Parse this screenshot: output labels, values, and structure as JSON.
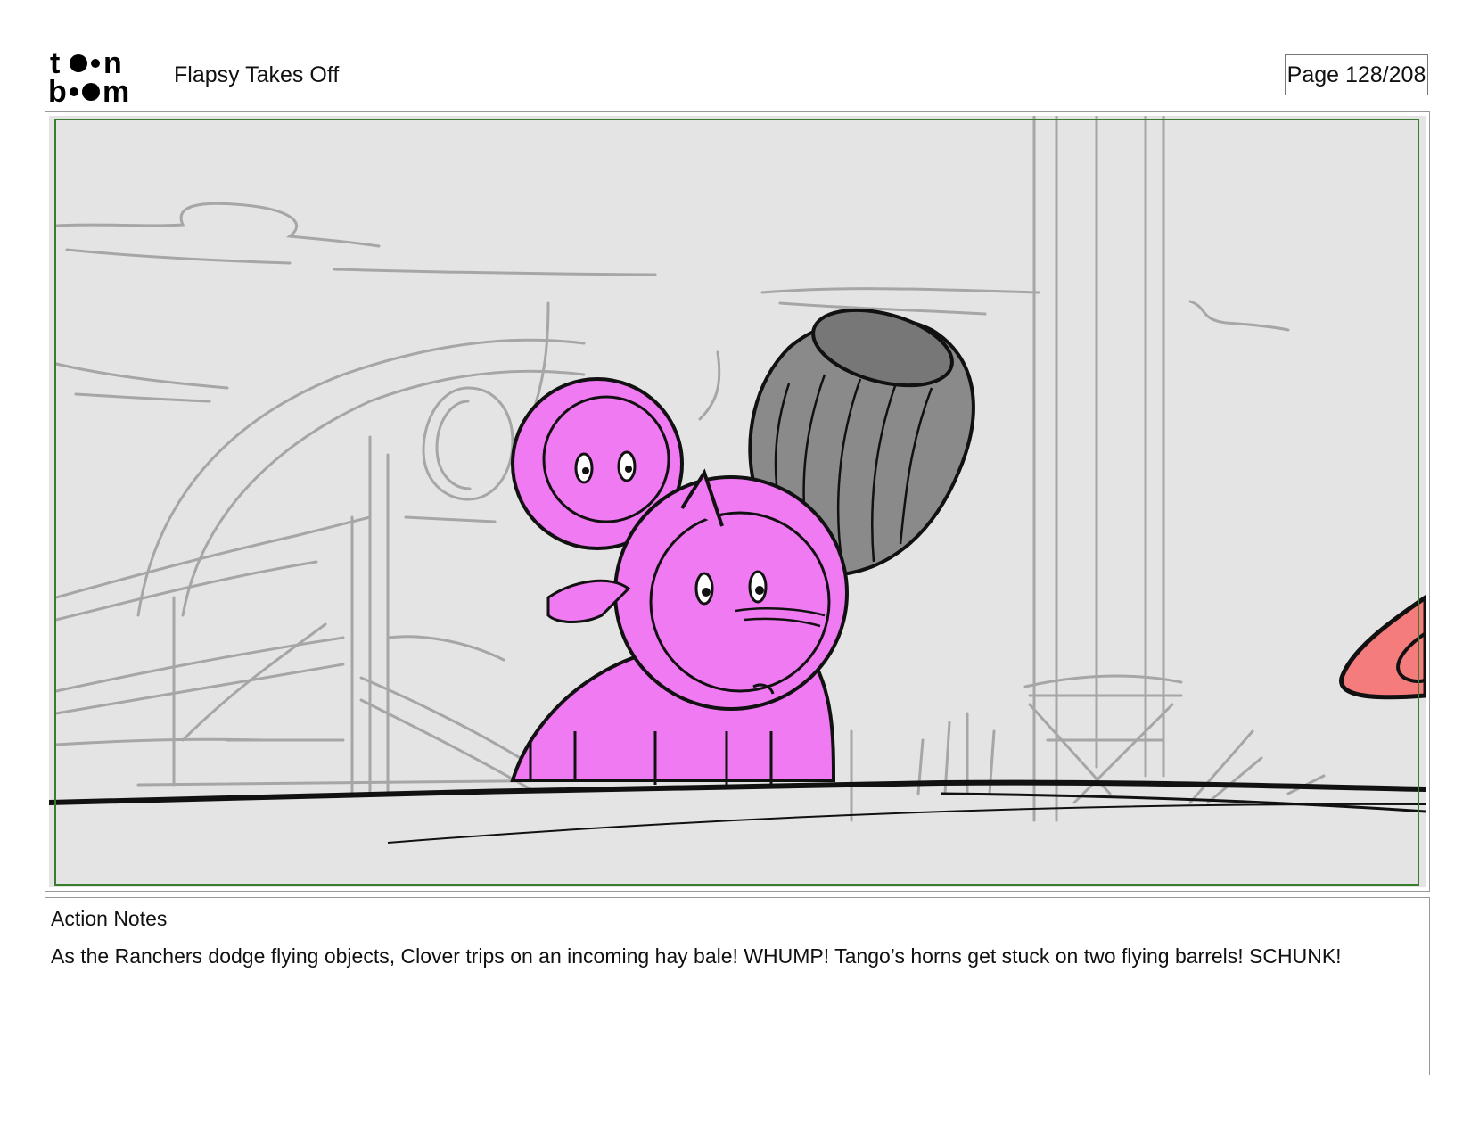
{
  "header": {
    "logo_text": "toon boom",
    "project_title": "Flapsy Takes Off",
    "page_label": "Page 128/208"
  },
  "panel": {
    "image_description_icons": [
      "storyboard-sketch"
    ],
    "colors": {
      "background": "#e4e4e4",
      "sketch_lines": "#a6a6a6",
      "character_fill": "#f07af2",
      "barrel_fill": "#8a8a8a",
      "cone_fill": "#f47c7c",
      "safe_frame": "#3a7d2c"
    }
  },
  "notes": {
    "heading": "Action Notes",
    "text": "As the Ranchers dodge flying objects, Clover trips on an incoming hay bale! WHUMP! Tango’s horns get stuck on two flying barrels! SCHUNK!"
  }
}
